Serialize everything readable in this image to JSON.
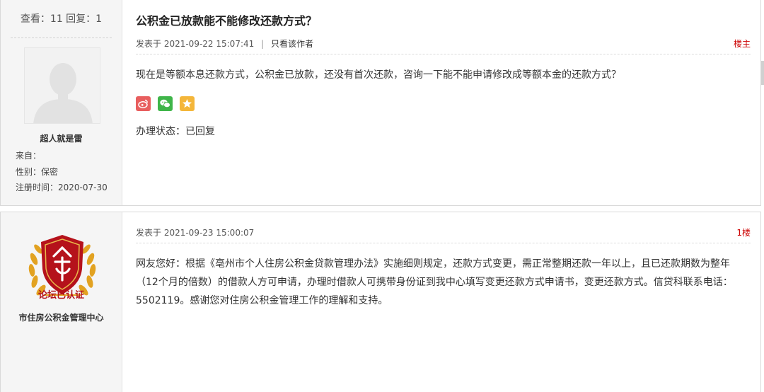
{
  "thread": {
    "stats": "查看：11 回复：1",
    "title": "公积金已放款能不能修改还款方式？"
  },
  "posts": [
    {
      "author": {
        "name": "超人就是雷",
        "from": "来自：",
        "gender": "性别：保密",
        "registered": "注册时间：2020-07-30"
      },
      "posted": "发表于 2021-09-22 15:07:41",
      "separator": "|",
      "only_author": "只看该作者",
      "floor": "楼主",
      "content": "现在是等额本息还款方式，公积金已放款，还没有首次还款，咨询一下能不能申请修改成等额本金的还款方式？",
      "shares": [
        "weibo-icon",
        "wechat-icon",
        "star-icon"
      ],
      "status": "办理状态：已回复"
    },
    {
      "author": {
        "name": "市住房公积金管理中心",
        "badge_text": "论坛已认证"
      },
      "posted": "发表于 2021-09-23 15:00:07",
      "floor": "1楼",
      "content": "网友您好：根据《亳州市个人住房公积金贷款管理办法》实施细则规定，还款方式变更，需正常整期还款一年以上，且已还款期数为整年（12个月的倍数）的借款人方可申请，办理时借款人可携带身份证到我中心填写变更还款方式申请书，变更还款方式。信贷科联系电话：5502119。感谢您对住房公积金管理工作的理解和支持。"
    }
  ],
  "colors": {
    "floor": "#cc0000",
    "weibo": "#e85e5e",
    "wechat": "#3fb549",
    "star": "#f4b63a",
    "badge_red": "#b5121b",
    "badge_gold": "#e2a221"
  }
}
